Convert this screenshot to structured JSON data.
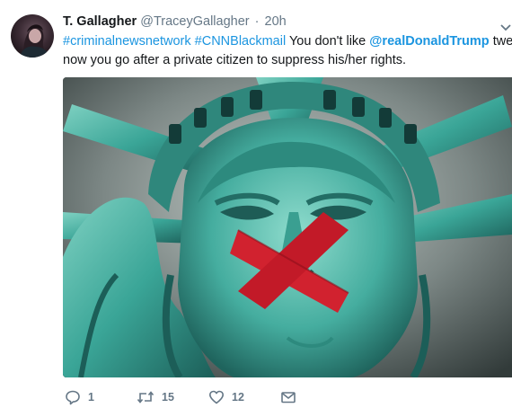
{
  "tweet": {
    "author_name": "T. Gallagher",
    "author_handle": "@TraceyGallagher",
    "separator": "·",
    "timestamp": "20h",
    "text": {
      "hashtag_1": "#criminalnewsnetwork",
      "hashtag_2": "#CNNBlackmail",
      "part_1": " You don't like ",
      "mention": "@realDonaldTrump",
      "part_2": " tweets",
      "line_2": "now you go after a private citizen to suppress his/her rights."
    },
    "media": {
      "image_subject": "statue-of-liberty-taped-mouth",
      "colors": {
        "statue": "#3aa597",
        "tape": "#d1222f",
        "sky": "#5a6563"
      }
    },
    "actions": {
      "reply_icon": "reply-icon",
      "reply_count": "1",
      "retweet_icon": "retweet-icon",
      "retweet_count": "15",
      "like_icon": "heart-icon",
      "like_count": "12",
      "dm_icon": "envelope-icon"
    }
  },
  "colors": {
    "link": "#1b95e0",
    "secondary_text": "#657786",
    "primary_text": "#14171a"
  }
}
